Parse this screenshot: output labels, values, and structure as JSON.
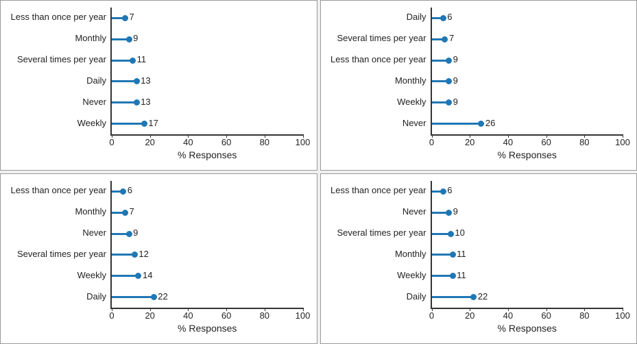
{
  "chart_data": [
    {
      "type": "bar",
      "orientation": "horizontal",
      "style": "lollipop",
      "xlabel": "% Responses",
      "xlim": [
        0,
        100
      ],
      "xticks": [
        0,
        20,
        40,
        60,
        80,
        100
      ],
      "categories": [
        "Less than once per year",
        "Monthly",
        "Several times per year",
        "Daily",
        "Never",
        "Weekly"
      ],
      "values": [
        7,
        9,
        11,
        13,
        13,
        17
      ]
    },
    {
      "type": "bar",
      "orientation": "horizontal",
      "style": "lollipop",
      "xlabel": "% Responses",
      "xlim": [
        0,
        100
      ],
      "xticks": [
        0,
        20,
        40,
        60,
        80,
        100
      ],
      "categories": [
        "Daily",
        "Several times per year",
        "Less than once per year",
        "Monthly",
        "Weekly",
        "Never"
      ],
      "values": [
        6,
        7,
        9,
        9,
        9,
        26
      ]
    },
    {
      "type": "bar",
      "orientation": "horizontal",
      "style": "lollipop",
      "xlabel": "% Responses",
      "xlim": [
        0,
        100
      ],
      "xticks": [
        0,
        20,
        40,
        60,
        80,
        100
      ],
      "categories": [
        "Less than once per year",
        "Monthly",
        "Never",
        "Several times per year",
        "Weekly",
        "Daily"
      ],
      "values": [
        6,
        7,
        9,
        12,
        14,
        22
      ]
    },
    {
      "type": "bar",
      "orientation": "horizontal",
      "style": "lollipop",
      "xlabel": "% Responses",
      "xlim": [
        0,
        100
      ],
      "xticks": [
        0,
        20,
        40,
        60,
        80,
        100
      ],
      "categories": [
        "Less than once per year",
        "Never",
        "Several times per year",
        "Monthly",
        "Weekly",
        "Daily"
      ],
      "values": [
        6,
        9,
        10,
        11,
        11,
        22
      ]
    }
  ]
}
